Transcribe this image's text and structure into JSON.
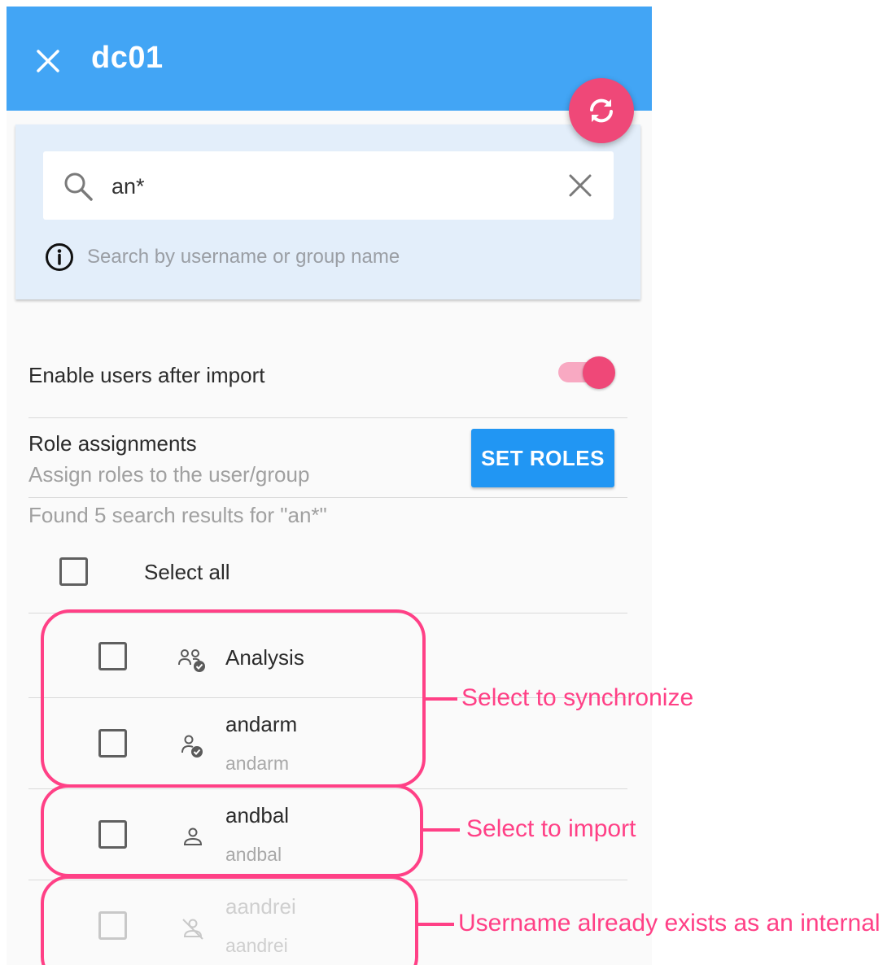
{
  "header": {
    "title": "dc01",
    "close_icon": "close-icon",
    "sync_icon": "sync-icon",
    "header_color": "#42a5f5",
    "fab_color": "#ef4878"
  },
  "search": {
    "value": "an*",
    "hint": "Search by username or group name",
    "search_icon": "search-icon",
    "clear_icon": "clear-icon",
    "info_icon": "info-icon"
  },
  "settings": {
    "enable_users_label": "Enable users after import",
    "enable_users_on": true,
    "role_assignments_label": "Role assignments",
    "role_assignments_sub": "Assign roles to the user/group",
    "set_roles_label": "SET ROLES"
  },
  "results": {
    "summary": "Found 5 search results for \"an*\"",
    "select_all_label": "Select all",
    "items": [
      {
        "name": "Analysis",
        "username": "",
        "icon": "group-sync-icon",
        "disabled": false
      },
      {
        "name": "andarm",
        "username": "andarm",
        "icon": "user-sync-icon",
        "disabled": false
      },
      {
        "name": "andbal",
        "username": "andbal",
        "icon": "user-icon",
        "disabled": false
      },
      {
        "name": "aandrei",
        "username": "aandrei",
        "icon": "user-off-icon",
        "disabled": true
      }
    ]
  },
  "annotations": {
    "sync": "Select to synchronize",
    "import": "Select to import",
    "exists": "Username already exists as an internal",
    "color": "#ff4086"
  }
}
